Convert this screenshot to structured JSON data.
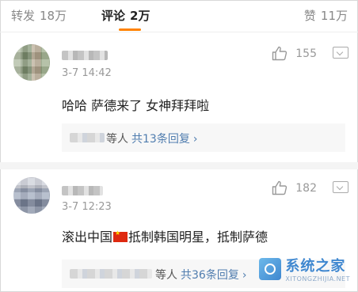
{
  "tabs": {
    "repost": {
      "label": "转发",
      "count": "18万"
    },
    "comment": {
      "label": "评论",
      "count": "2万"
    },
    "like": {
      "label": "赞",
      "count": "11万"
    }
  },
  "comments": [
    {
      "time": "3-7 14:42",
      "likes": "155",
      "text": "哈哈 萨德来了 女神拜拜啦",
      "replies": {
        "suffix": "等人",
        "count_text": "共13条回复",
        "arrow": "›"
      }
    },
    {
      "time": "3-7 12:23",
      "likes": "182",
      "text_before_flag": "滚出中国",
      "text_after_flag": "抵制韩国明星，抵制萨德",
      "replies": {
        "suffix": "等人",
        "count_text": "共36条回复",
        "arrow": "›"
      }
    }
  ],
  "watermark": {
    "title": "系统之家",
    "url": "XITONGZHIJIA.NET"
  },
  "colors": {
    "accent": "#ff8200",
    "link": "#507daf",
    "flag_red": "#de2910"
  },
  "icons": [
    "thumbs-up-icon",
    "dropdown-more-icon",
    "chevron-right-icon",
    "china-flag-icon"
  ]
}
